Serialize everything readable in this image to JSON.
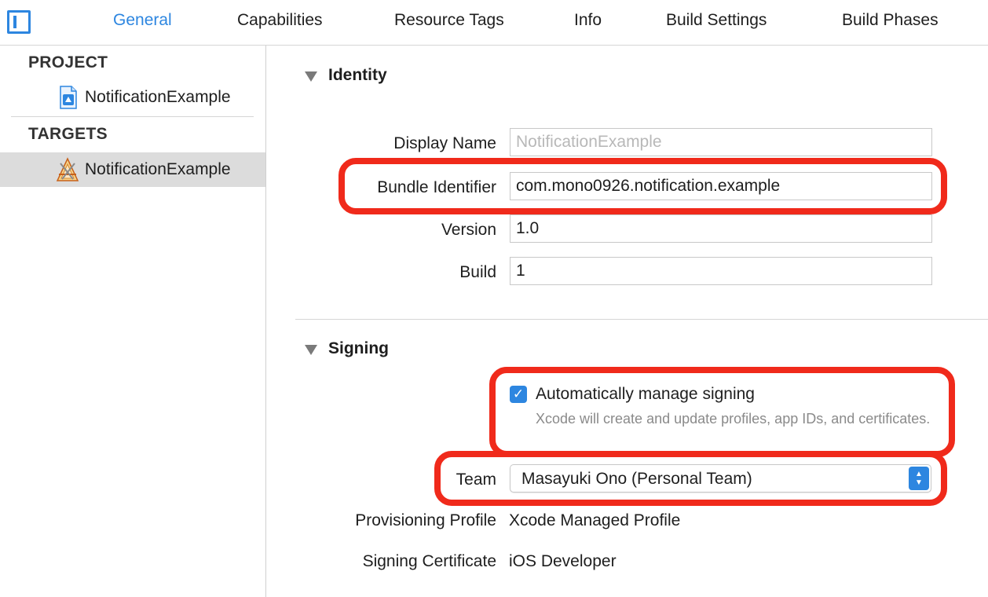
{
  "tabs": [
    {
      "label": "General",
      "active": true
    },
    {
      "label": "Capabilities"
    },
    {
      "label": "Resource Tags"
    },
    {
      "label": "Info"
    },
    {
      "label": "Build Settings"
    },
    {
      "label": "Build Phases"
    }
  ],
  "sidebar": {
    "project_header": "PROJECT",
    "project_item": "NotificationExample",
    "targets_header": "TARGETS",
    "target_item": "NotificationExample"
  },
  "identity": {
    "title": "Identity",
    "display_name_label": "Display Name",
    "display_name_placeholder": "NotificationExample",
    "bundle_identifier_label": "Bundle Identifier",
    "bundle_identifier_value": "com.mono0926.notification.example",
    "version_label": "Version",
    "version_value": "1.0",
    "build_label": "Build",
    "build_value": "1"
  },
  "signing": {
    "title": "Signing",
    "auto_manage_label": "Automatically manage signing",
    "auto_manage_checked": true,
    "auto_manage_desc": "Xcode will create and update profiles, app IDs, and certificates.",
    "team_label": "Team",
    "team_value": "Masayuki Ono (Personal Team)",
    "provisioning_label": "Provisioning Profile",
    "provisioning_value": "Xcode Managed Profile",
    "certificate_label": "Signing Certificate",
    "certificate_value": "iOS Developer"
  },
  "colors": {
    "accent": "#2d86e0",
    "highlight": "#f02a1b",
    "selection": "#dcdcdc"
  }
}
